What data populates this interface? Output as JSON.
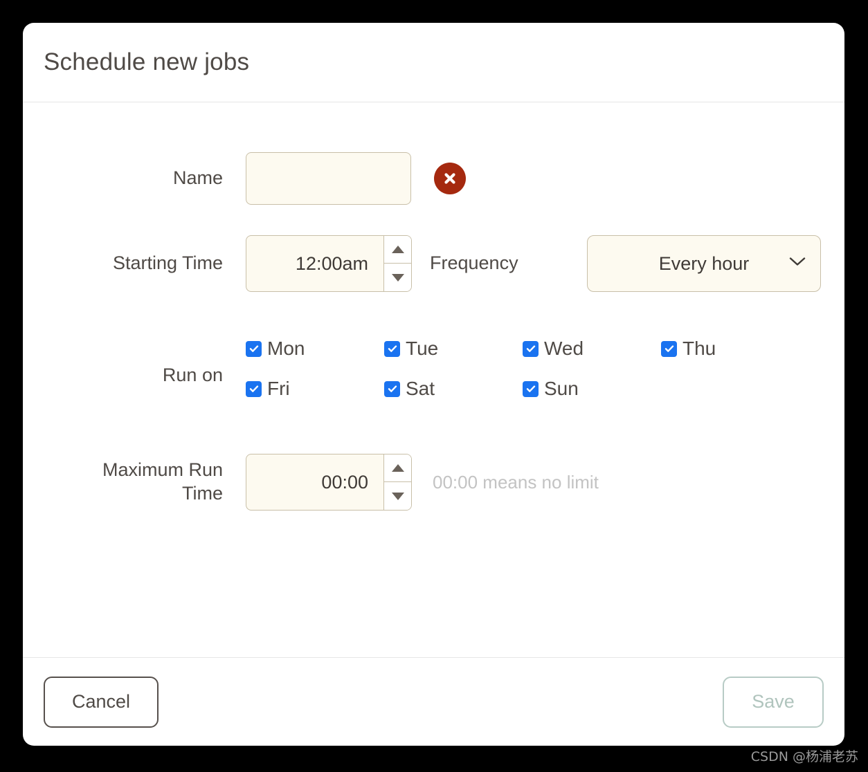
{
  "dialog": {
    "title": "Schedule new jobs"
  },
  "fields": {
    "name": {
      "label": "Name",
      "value": "",
      "placeholder": "",
      "error_icon": "error-x-icon"
    },
    "starting_time": {
      "label": "Starting Time",
      "value": "12:00am",
      "spinner_up_icon": "triangle-up-icon",
      "spinner_down_icon": "triangle-down-icon"
    },
    "frequency": {
      "label": "Frequency",
      "value": "Every hour",
      "chevron_icon": "chevron-down-icon",
      "options": [
        "Every hour"
      ]
    },
    "run_on": {
      "label": "Run on",
      "days": [
        {
          "label": "Mon",
          "checked": true
        },
        {
          "label": "Tue",
          "checked": true
        },
        {
          "label": "Wed",
          "checked": true
        },
        {
          "label": "Thu",
          "checked": true
        },
        {
          "label": "Fri",
          "checked": true
        },
        {
          "label": "Sat",
          "checked": true
        },
        {
          "label": "Sun",
          "checked": true
        }
      ]
    },
    "maximum_run_time": {
      "label_line1": "Maximum Run",
      "label_line2": "Time",
      "value": "00:00",
      "hint": "00:00 means no limit",
      "spinner_up_icon": "triangle-up-icon",
      "spinner_down_icon": "triangle-down-icon"
    }
  },
  "footer": {
    "cancel_label": "Cancel",
    "save_label": "Save"
  },
  "watermark": {
    "text": "CSDN @杨浦老苏"
  },
  "colors": {
    "background": "#000000",
    "card": "#ffffff",
    "input_bg": "#fdfaf0",
    "input_border": "#c8bfa8",
    "text": "#4f4a46",
    "checkbox_blue": "#1a73f0",
    "error_red": "#a5290f",
    "save_disabled": "#b7cbc5",
    "hint_gray": "#c3c3c3"
  }
}
